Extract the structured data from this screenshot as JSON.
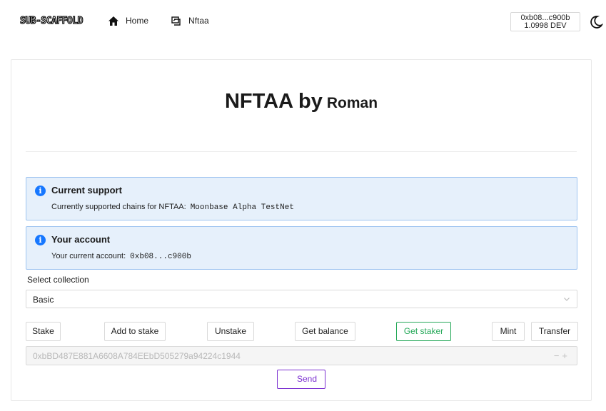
{
  "header": {
    "logo": "SUB-SCAFFOLD",
    "nav": [
      {
        "label": "Home",
        "icon": "home-icon"
      },
      {
        "label": "Nftaa",
        "icon": "nft-icon"
      }
    ],
    "account": {
      "address": "0xb08...c900b",
      "balance": "1.0998 DEV"
    },
    "theme_icon": "moon-icon"
  },
  "main": {
    "title": "NFTAA by",
    "owner": "Roman",
    "alerts": [
      {
        "title": "Current support",
        "label": "Currently supported chains for NFTAA:",
        "value": "Moonbase Alpha TestNet"
      },
      {
        "title": "Your account",
        "label": "Your current account:",
        "value": "0xb08...c900b"
      }
    ],
    "collection": {
      "label": "Select collection",
      "selected": "Basic"
    },
    "actions": [
      "Stake",
      "Add to stake",
      "Unstake",
      "Get balance",
      "Get staker",
      "Mint",
      "Transfer"
    ],
    "address_input": {
      "value": "0xbBD487E881A6608A784EEbD505279a94224c1944"
    },
    "send_label": "Send"
  },
  "colors": {
    "accent_info": "#1677ff",
    "info_bg": "#e6f0fb",
    "active_button": "#27a95a",
    "send_button": "#7b2fd0"
  }
}
